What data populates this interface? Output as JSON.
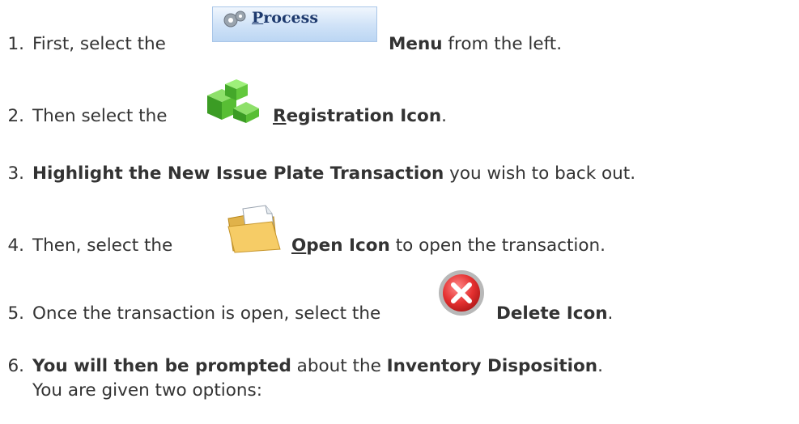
{
  "steps": [
    {
      "num": "1.",
      "pre": "First, select the",
      "bold": "Menu",
      "post": " from the left."
    },
    {
      "num": "2.",
      "pre": "Then select the",
      "bold_first": "R",
      "bold_rest": "egistration Icon",
      "post": "."
    },
    {
      "num": "3.",
      "bold": "Highlight the New Issue Plate Transaction",
      "post": " you wish to back out."
    },
    {
      "num": "4.",
      "pre": "Then, select the",
      "bold_first": "O",
      "bold_rest": "pen Icon",
      "post": " to open the transaction."
    },
    {
      "num": "5.",
      "pre": "Once the transaction is open, select the",
      "bold": "Delete Icon",
      "post": "."
    },
    {
      "num": "6.",
      "bold": "You will then be prompted",
      "mid": " about the ",
      "bold2": "Inventory Disposition",
      "post": ".",
      "line2": "You are given two options:"
    }
  ],
  "process_button": {
    "first": "P",
    "rest": "rocess",
    "icon": "gear-icon"
  },
  "icons": {
    "registration": "green-cubes-icon",
    "open": "folder-icon",
    "delete": "red-x-icon"
  }
}
